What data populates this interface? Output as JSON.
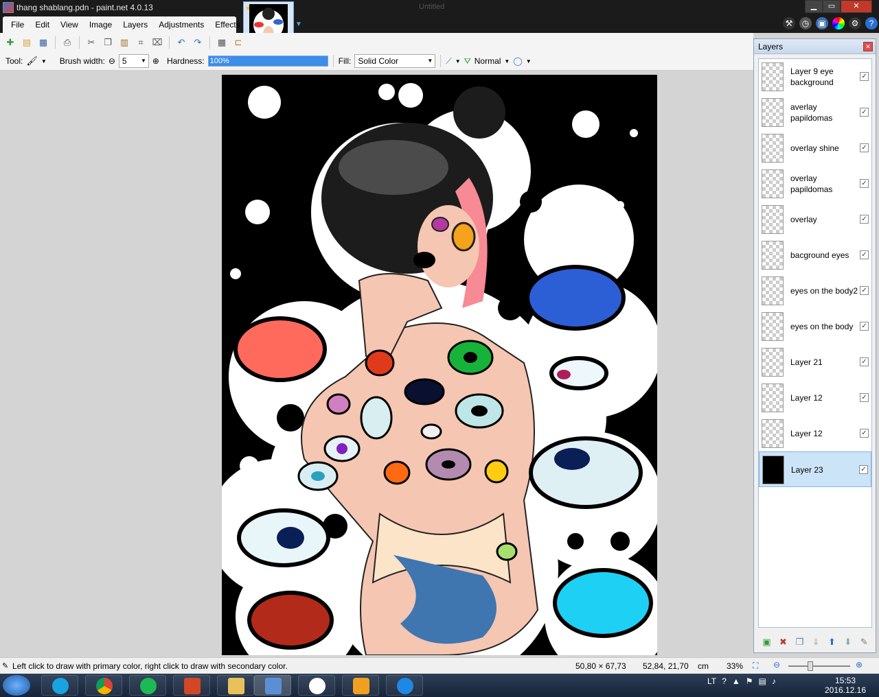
{
  "window": {
    "title": "thang shablang.pdn - paint.net 4.0.13",
    "center_title": "Untitled",
    "minimize": "▁",
    "maximize": "▭",
    "close": "✕"
  },
  "menu": [
    {
      "label": "File"
    },
    {
      "label": "Edit"
    },
    {
      "label": "View"
    },
    {
      "label": "Image"
    },
    {
      "label": "Layers"
    },
    {
      "label": "Adjustments"
    },
    {
      "label": "Effects"
    }
  ],
  "toolbar_icons": [
    "new-icon",
    "open-icon",
    "save-icon",
    "print-icon",
    "cut-icon",
    "copy-icon",
    "paste-icon",
    "crop-icon",
    "deselect-icon",
    "undo-icon",
    "redo-icon",
    "grid-icon",
    "ruler-icon"
  ],
  "options": {
    "tool_label": "Tool:",
    "brush_width_label": "Brush width:",
    "brush_width_value": "5",
    "hardness_label": "Hardness:",
    "hardness_value": "100%",
    "hardness_level": 1.0,
    "fill_label": "Fill:",
    "fill_value": "Solid Color",
    "blend_value": "Normal"
  },
  "layers_panel": {
    "title": "Layers",
    "layers": [
      {
        "name": "Layer 9 eye background",
        "visible": true,
        "selected": false
      },
      {
        "name": "averlay papildomas",
        "visible": true,
        "selected": false
      },
      {
        "name": "overlay shine",
        "visible": true,
        "selected": false
      },
      {
        "name": "overlay papildomas",
        "visible": true,
        "selected": false
      },
      {
        "name": "overlay",
        "visible": true,
        "selected": false
      },
      {
        "name": "bacground eyes",
        "visible": true,
        "selected": false
      },
      {
        "name": "eyes on the body2",
        "visible": true,
        "selected": false
      },
      {
        "name": "eyes on the body",
        "visible": true,
        "selected": false
      },
      {
        "name": "Layer 21",
        "visible": true,
        "selected": false
      },
      {
        "name": "Layer 12",
        "visible": true,
        "selected": false
      },
      {
        "name": "Layer 12",
        "visible": true,
        "selected": false
      },
      {
        "name": "Layer 23",
        "visible": true,
        "selected": true
      }
    ]
  },
  "status": {
    "message": "Left click to draw with primary color, right click to draw with secondary color.",
    "size": "50,80 × 67,73",
    "position": "52,84, 21,70",
    "unit": "cm",
    "zoom": "33%"
  },
  "taskbar": {
    "language": "LT",
    "time": "15:53",
    "date": "2016.12.16"
  },
  "colors": {
    "accent": "#3d8ee8",
    "chrome": "#1b1b1b",
    "panel_selected": "#cce4f7"
  }
}
